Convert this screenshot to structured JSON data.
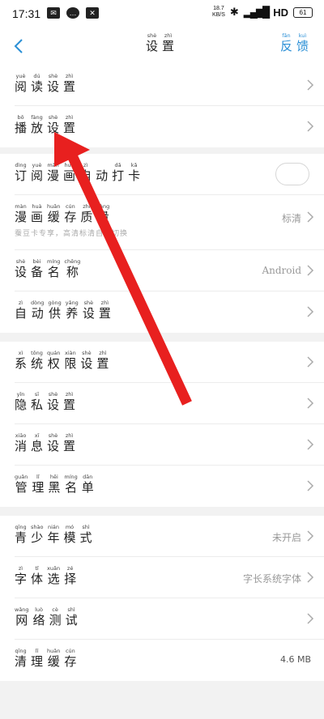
{
  "status_bar": {
    "time": "17:31",
    "net_speed": "18.7",
    "net_unit": "KB/S",
    "signal_label": "HD",
    "battery": "61"
  },
  "header": {
    "title": [
      [
        "shè",
        "设"
      ],
      [
        "zhì",
        "置"
      ]
    ],
    "feedback": [
      [
        "fǎn",
        "反"
      ],
      [
        "kuì",
        "馈"
      ]
    ]
  },
  "rows": {
    "reading": [
      [
        "yuè",
        "阅"
      ],
      [
        "dú",
        "读"
      ],
      [
        "shè",
        "设"
      ],
      [
        "zhì",
        "置"
      ]
    ],
    "playback": [
      [
        "bō",
        "播"
      ],
      [
        "fàng",
        "放"
      ],
      [
        "shè",
        "设"
      ],
      [
        "zhì",
        "置"
      ]
    ],
    "subscribe": [
      [
        "dìng",
        "订"
      ],
      [
        "yuè",
        "阅"
      ],
      [
        "màn",
        "漫"
      ],
      [
        "huà",
        "画"
      ],
      [
        "zì",
        "自"
      ],
      [
        "",
        "动"
      ],
      [
        "dǎ",
        "打"
      ],
      [
        "kǎ",
        "卡"
      ]
    ],
    "cache_quality": [
      [
        "màn",
        "漫"
      ],
      [
        "huà",
        "画"
      ],
      [
        "huǎn",
        "缓"
      ],
      [
        "cún",
        "存"
      ],
      [
        "zhì",
        "质"
      ],
      [
        "liàng",
        "量"
      ]
    ],
    "cache_quality_value": "标清",
    "cache_quality_sub": "蚕豆卡专享，高清标清自动切换",
    "device_name": [
      [
        "shè",
        "设"
      ],
      [
        "bèi",
        "备"
      ],
      [
        "míng",
        "名"
      ],
      [
        "chēng",
        "称"
      ]
    ],
    "device_name_value": "Android",
    "auto_buy": [
      [
        "zì",
        "自"
      ],
      [
        "dòng",
        "动"
      ],
      [
        "gòng",
        "供"
      ],
      [
        "yǎng",
        "养"
      ],
      [
        "shè",
        "设"
      ],
      [
        "zhì",
        "置"
      ]
    ],
    "permissions": [
      [
        "xì",
        "系"
      ],
      [
        "tǒng",
        "统"
      ],
      [
        "quán",
        "权"
      ],
      [
        "xiàn",
        "限"
      ],
      [
        "shè",
        "设"
      ],
      [
        "zhì",
        "置"
      ]
    ],
    "privacy": [
      [
        "yǐn",
        "隐"
      ],
      [
        "sī",
        "私"
      ],
      [
        "shè",
        "设"
      ],
      [
        "zhì",
        "置"
      ]
    ],
    "message": [
      [
        "xiāo",
        "消"
      ],
      [
        "xī",
        "息"
      ],
      [
        "shè",
        "设"
      ],
      [
        "zhì",
        "置"
      ]
    ],
    "blacklist": [
      [
        "guǎn",
        "管"
      ],
      [
        "lǐ",
        "理"
      ],
      [
        "hēi",
        "黑"
      ],
      [
        "míng",
        "名"
      ],
      [
        "dān",
        "单"
      ]
    ],
    "teen_mode": [
      [
        "qīng",
        "青"
      ],
      [
        "shào",
        "少"
      ],
      [
        "nián",
        "年"
      ],
      [
        "mó",
        "模"
      ],
      [
        "shì",
        "式"
      ]
    ],
    "teen_mode_value": "未开启",
    "font_select": [
      [
        "zì",
        "字"
      ],
      [
        "tǐ",
        "体"
      ],
      [
        "xuǎn",
        "选"
      ],
      [
        "zé",
        "择"
      ]
    ],
    "font_select_value": "字长系统字体",
    "network_test": [
      [
        "wǎng",
        "网"
      ],
      [
        "luò",
        "络"
      ],
      [
        "cè",
        "测"
      ],
      [
        "shì",
        "试"
      ]
    ],
    "clear_cache": [
      [
        "qīng",
        "清"
      ],
      [
        "lǐ",
        "理"
      ],
      [
        "huǎn",
        "缓"
      ],
      [
        "cún",
        "存"
      ]
    ],
    "clear_cache_value": "4.6 MB"
  },
  "colors": {
    "accent": "#2a8fd6",
    "annotation_arrow": "#e8201f",
    "background": "#f2f2f2"
  }
}
